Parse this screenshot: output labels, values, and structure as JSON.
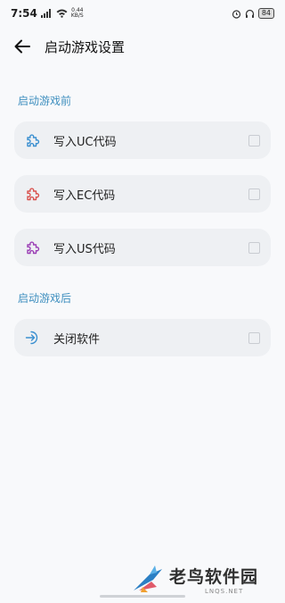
{
  "status_bar": {
    "time": "7:54",
    "net_speed_value": "0.44",
    "net_speed_unit": "KB/S",
    "battery": "84"
  },
  "header": {
    "title": "启动游戏设置"
  },
  "sections": [
    {
      "label": "启动游戏前",
      "items": [
        {
          "label": "写入UC代码",
          "icon": "puzzle-icon",
          "icon_color": "#3a8fd0",
          "checked": false
        },
        {
          "label": "写入EC代码",
          "icon": "puzzle-icon",
          "icon_color": "#d9534f",
          "checked": false
        },
        {
          "label": "写入US代码",
          "icon": "puzzle-icon",
          "icon_color": "#9b3fb5",
          "checked": false
        }
      ]
    },
    {
      "label": "启动游戏后",
      "items": [
        {
          "label": "关闭软件",
          "icon": "exit-icon",
          "icon_color": "#3a8fd0",
          "checked": false
        }
      ]
    }
  ],
  "watermark": {
    "text": "老鸟软件园",
    "sub": "LNQS.NET"
  },
  "colors": {
    "accent": "#3f8fbf",
    "card_bg": "#eef0f3",
    "page_bg": "#f8f9fb"
  }
}
